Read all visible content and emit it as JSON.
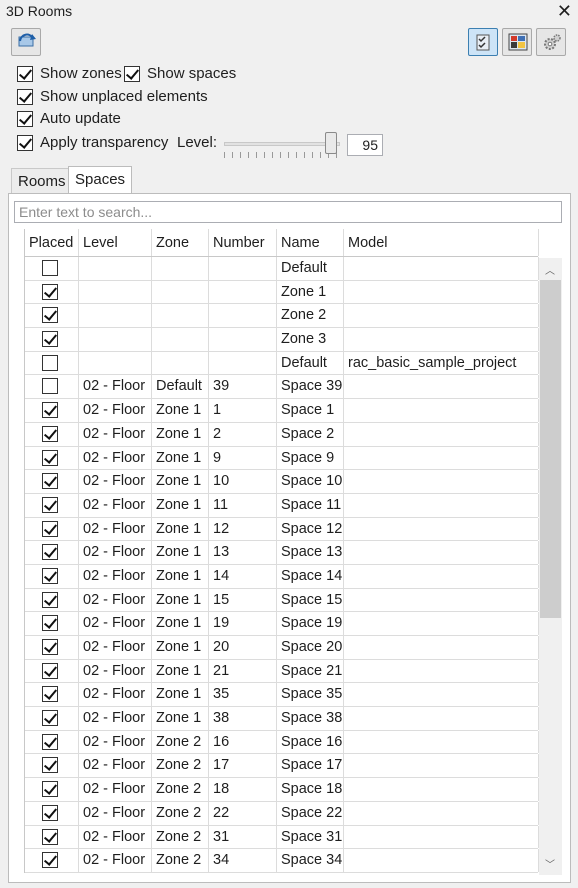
{
  "window": {
    "title": "3D Rooms"
  },
  "toolbar": {
    "refresh_icon": "refresh-icon",
    "right_icons": [
      "filter-placed-icon",
      "color-scheme-icon",
      "settings-icon"
    ]
  },
  "options": {
    "show_zones": {
      "label": "Show zones",
      "checked": true
    },
    "show_spaces": {
      "label": "Show spaces",
      "checked": true
    },
    "show_unplaced": {
      "label": "Show unplaced elements",
      "checked": true
    },
    "auto_update": {
      "label": "Auto update",
      "checked": true
    },
    "apply_transparency": {
      "label": "Apply transparency",
      "checked": true
    },
    "level_label": "Level:",
    "level_value": "95",
    "level_fraction": 0.95
  },
  "tabs": [
    {
      "label": "Rooms",
      "active": false
    },
    {
      "label": "Spaces",
      "active": true
    }
  ],
  "search": {
    "placeholder": "Enter text to search..."
  },
  "table": {
    "columns": [
      "Placed",
      "Level",
      "Zone",
      "Number",
      "Name",
      "Model"
    ],
    "rows": [
      {
        "placed": false,
        "level": "",
        "zone": "",
        "number": "",
        "name": "Default",
        "model": ""
      },
      {
        "placed": true,
        "level": "",
        "zone": "",
        "number": "",
        "name": "Zone 1",
        "model": ""
      },
      {
        "placed": true,
        "level": "",
        "zone": "",
        "number": "",
        "name": "Zone 2",
        "model": ""
      },
      {
        "placed": true,
        "level": "",
        "zone": "",
        "number": "",
        "name": "Zone 3",
        "model": ""
      },
      {
        "placed": false,
        "level": "",
        "zone": "",
        "number": "",
        "name": "Default",
        "model": "rac_basic_sample_project"
      },
      {
        "placed": false,
        "level": "02 - Floor",
        "zone": "Default",
        "number": "39",
        "name": "Space 39",
        "model": ""
      },
      {
        "placed": true,
        "level": "02 - Floor",
        "zone": "Zone 1",
        "number": "1",
        "name": "Space 1",
        "model": ""
      },
      {
        "placed": true,
        "level": "02 - Floor",
        "zone": "Zone 1",
        "number": "2",
        "name": "Space 2",
        "model": ""
      },
      {
        "placed": true,
        "level": "02 - Floor",
        "zone": "Zone 1",
        "number": "9",
        "name": "Space 9",
        "model": ""
      },
      {
        "placed": true,
        "level": "02 - Floor",
        "zone": "Zone 1",
        "number": "10",
        "name": "Space 10",
        "model": ""
      },
      {
        "placed": true,
        "level": "02 - Floor",
        "zone": "Zone 1",
        "number": "11",
        "name": "Space 11",
        "model": ""
      },
      {
        "placed": true,
        "level": "02 - Floor",
        "zone": "Zone 1",
        "number": "12",
        "name": "Space 12",
        "model": ""
      },
      {
        "placed": true,
        "level": "02 - Floor",
        "zone": "Zone 1",
        "number": "13",
        "name": "Space 13",
        "model": ""
      },
      {
        "placed": true,
        "level": "02 - Floor",
        "zone": "Zone 1",
        "number": "14",
        "name": "Space 14",
        "model": ""
      },
      {
        "placed": true,
        "level": "02 - Floor",
        "zone": "Zone 1",
        "number": "15",
        "name": "Space 15",
        "model": ""
      },
      {
        "placed": true,
        "level": "02 - Floor",
        "zone": "Zone 1",
        "number": "19",
        "name": "Space 19",
        "model": ""
      },
      {
        "placed": true,
        "level": "02 - Floor",
        "zone": "Zone 1",
        "number": "20",
        "name": "Space 20",
        "model": ""
      },
      {
        "placed": true,
        "level": "02 - Floor",
        "zone": "Zone 1",
        "number": "21",
        "name": "Space 21",
        "model": ""
      },
      {
        "placed": true,
        "level": "02 - Floor",
        "zone": "Zone 1",
        "number": "35",
        "name": "Space 35",
        "model": ""
      },
      {
        "placed": true,
        "level": "02 - Floor",
        "zone": "Zone 1",
        "number": "38",
        "name": "Space 38",
        "model": ""
      },
      {
        "placed": true,
        "level": "02 - Floor",
        "zone": "Zone 2",
        "number": "16",
        "name": "Space 16",
        "model": ""
      },
      {
        "placed": true,
        "level": "02 - Floor",
        "zone": "Zone 2",
        "number": "17",
        "name": "Space 17",
        "model": ""
      },
      {
        "placed": true,
        "level": "02 - Floor",
        "zone": "Zone 2",
        "number": "18",
        "name": "Space 18",
        "model": ""
      },
      {
        "placed": true,
        "level": "02 - Floor",
        "zone": "Zone 2",
        "number": "22",
        "name": "Space 22",
        "model": ""
      },
      {
        "placed": true,
        "level": "02 - Floor",
        "zone": "Zone 2",
        "number": "31",
        "name": "Space 31",
        "model": ""
      },
      {
        "placed": true,
        "level": "02 - Floor",
        "zone": "Zone 2",
        "number": "34",
        "name": "Space 34",
        "model": ""
      }
    ]
  }
}
